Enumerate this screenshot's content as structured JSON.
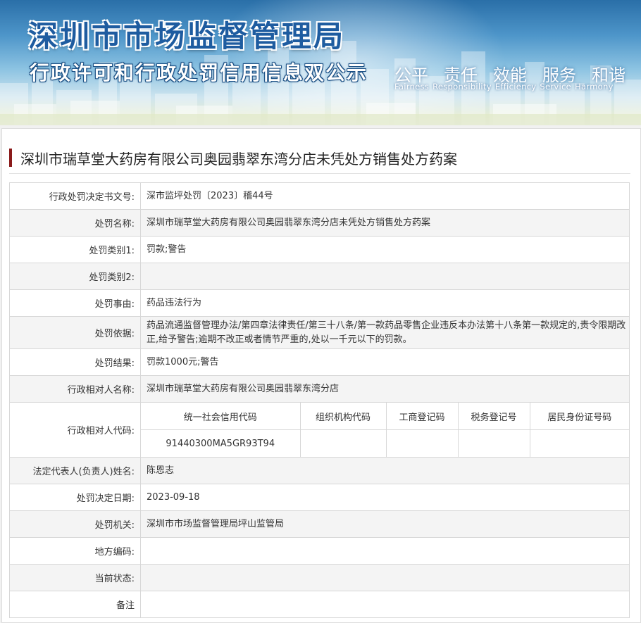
{
  "banner": {
    "title": "深圳市市场监督管理局",
    "subtitle": "行政许可和行政处罚信用信息双公示",
    "slogan_cn": [
      "公平",
      "责任",
      "效能",
      "服务",
      "和谐"
    ],
    "slogan_en": [
      "Fairness",
      "Responsibility",
      "Efficiency",
      "Service",
      "Harmony"
    ]
  },
  "case_title": "深圳市瑞草堂大药房有限公司奥园翡翠东湾分店未凭处方销售处方药案",
  "rows": [
    {
      "label": "行政处罚决定书文号:",
      "value": "深市监坪处罚〔2023〕稽44号"
    },
    {
      "label": "处罚名称:",
      "value": "深圳市瑞草堂大药房有限公司奥园翡翠东湾分店未凭处方销售处方药案"
    },
    {
      "label": "处罚类别1:",
      "value": "罚款;警告"
    },
    {
      "label": "处罚类别2:",
      "value": ""
    },
    {
      "label": "处罚事由:",
      "value": "药品违法行为"
    },
    {
      "label": "处罚依据:",
      "value": "药品流通监督管理办法/第四章法律责任/第三十八条/第一款药品零售企业违反本办法第十八条第一款规定的,责令限期改正,给予警告;逾期不改正或者情节严重的,处以一千元以下的罚款。"
    },
    {
      "label": "处罚结果:",
      "value": "罚款1000元;警告"
    },
    {
      "label": "行政相对人名称:",
      "value": "深圳市瑞草堂大药房有限公司奥园翡翠东湾分店"
    }
  ],
  "code_row": {
    "label": "行政相对人代码:",
    "headers": [
      "统一社会信用代码",
      "组织机构代码",
      "工商登记码",
      "税务登记号",
      "居民身份证号码"
    ],
    "values": [
      "91440300MA5GR93T94",
      "",
      "",
      "",
      ""
    ]
  },
  "rows2": [
    {
      "label": "法定代表人(负责人)姓名:",
      "value": "陈恩志"
    },
    {
      "label": "处罚决定日期:",
      "value": "2023-09-18"
    },
    {
      "label": "处罚机关:",
      "value": "深圳市市场监督管理局坪山监管局"
    },
    {
      "label": "地方编码:",
      "value": ""
    },
    {
      "label": "当前状态:",
      "value": ""
    },
    {
      "label": "备注",
      "value": ""
    }
  ],
  "colors": {
    "accent_bar": "#8a1a1a",
    "banner_title": "#1e5ca0"
  }
}
